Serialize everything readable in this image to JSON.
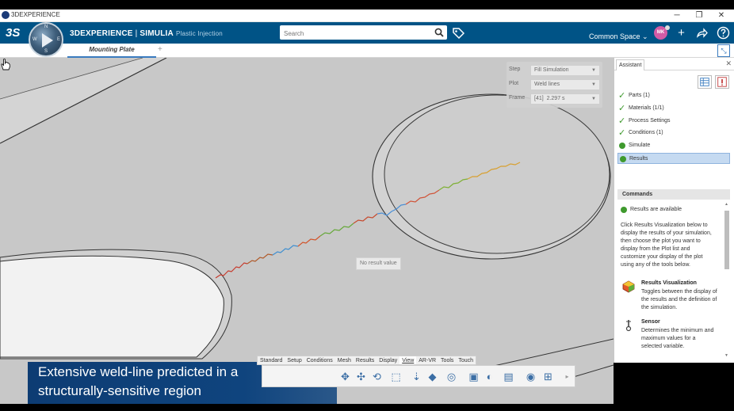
{
  "window": {
    "title": "3DEXPERIENCE",
    "minimize": "─",
    "restore": "❐",
    "close": "✕"
  },
  "header": {
    "brand_prefix": "3DEXPERIENCE",
    "brand_sep": " | ",
    "brand_product": "SIMULIA",
    "brand_app": "Plastic Injection",
    "search_placeholder": "Search",
    "space_label": "Common Space",
    "avatar_initials": "MK",
    "ds_logo": "3S",
    "compass_quadrants": [
      "N",
      "W",
      "E",
      "S"
    ]
  },
  "tabs": {
    "active_label": "Mounting Plate",
    "add_label": "+"
  },
  "viewport": {
    "step_label": "Step",
    "step_value": "Fill Simulation",
    "plot_label": "Plot",
    "plot_value": "Weld lines",
    "frame_label": "Frame",
    "frame_index": "[41]",
    "frame_value": "2.297 s",
    "tooltip": "No result value"
  },
  "actionbar": {
    "tabs": [
      "Standard",
      "Setup",
      "Conditions",
      "Mesh",
      "Results",
      "Display",
      "View",
      "AR-VR",
      "Tools",
      "Touch"
    ],
    "active_tab": "View"
  },
  "caption": {
    "line1": "Extensive weld-line predicted in a",
    "line2": "structurally-sensitive region"
  },
  "assistant": {
    "tab_label": "Assistant",
    "close": "✕",
    "steps": [
      {
        "label": "Parts (1)",
        "status": "done"
      },
      {
        "label": "Materials (1/1)",
        "status": "done"
      },
      {
        "label": "Process Settings",
        "status": "done"
      },
      {
        "label": "Conditions (1)",
        "status": "done"
      },
      {
        "label": "Simulate",
        "status": "ready"
      },
      {
        "label": "Results",
        "status": "ready",
        "selected": true
      }
    ],
    "commands_title": "Commands",
    "results_available": "Results are available",
    "instructions": "Click Results Visualization below to display the results of your simulation, then choose the plot you want to display from the Plot list and customize your display of the plot using any of the tools below.",
    "items": [
      {
        "title": "Results Visualization",
        "desc": "Toggles between the display of the results and the definition of the simulation."
      },
      {
        "title": "Sensor",
        "desc": "Determines the minimum and maximum values for a selected variable."
      }
    ]
  },
  "colors": {
    "topbar": "#005386",
    "selection": "#c5daf1",
    "success": "#3f9a2e",
    "caption_bg": "#0d3c73"
  }
}
